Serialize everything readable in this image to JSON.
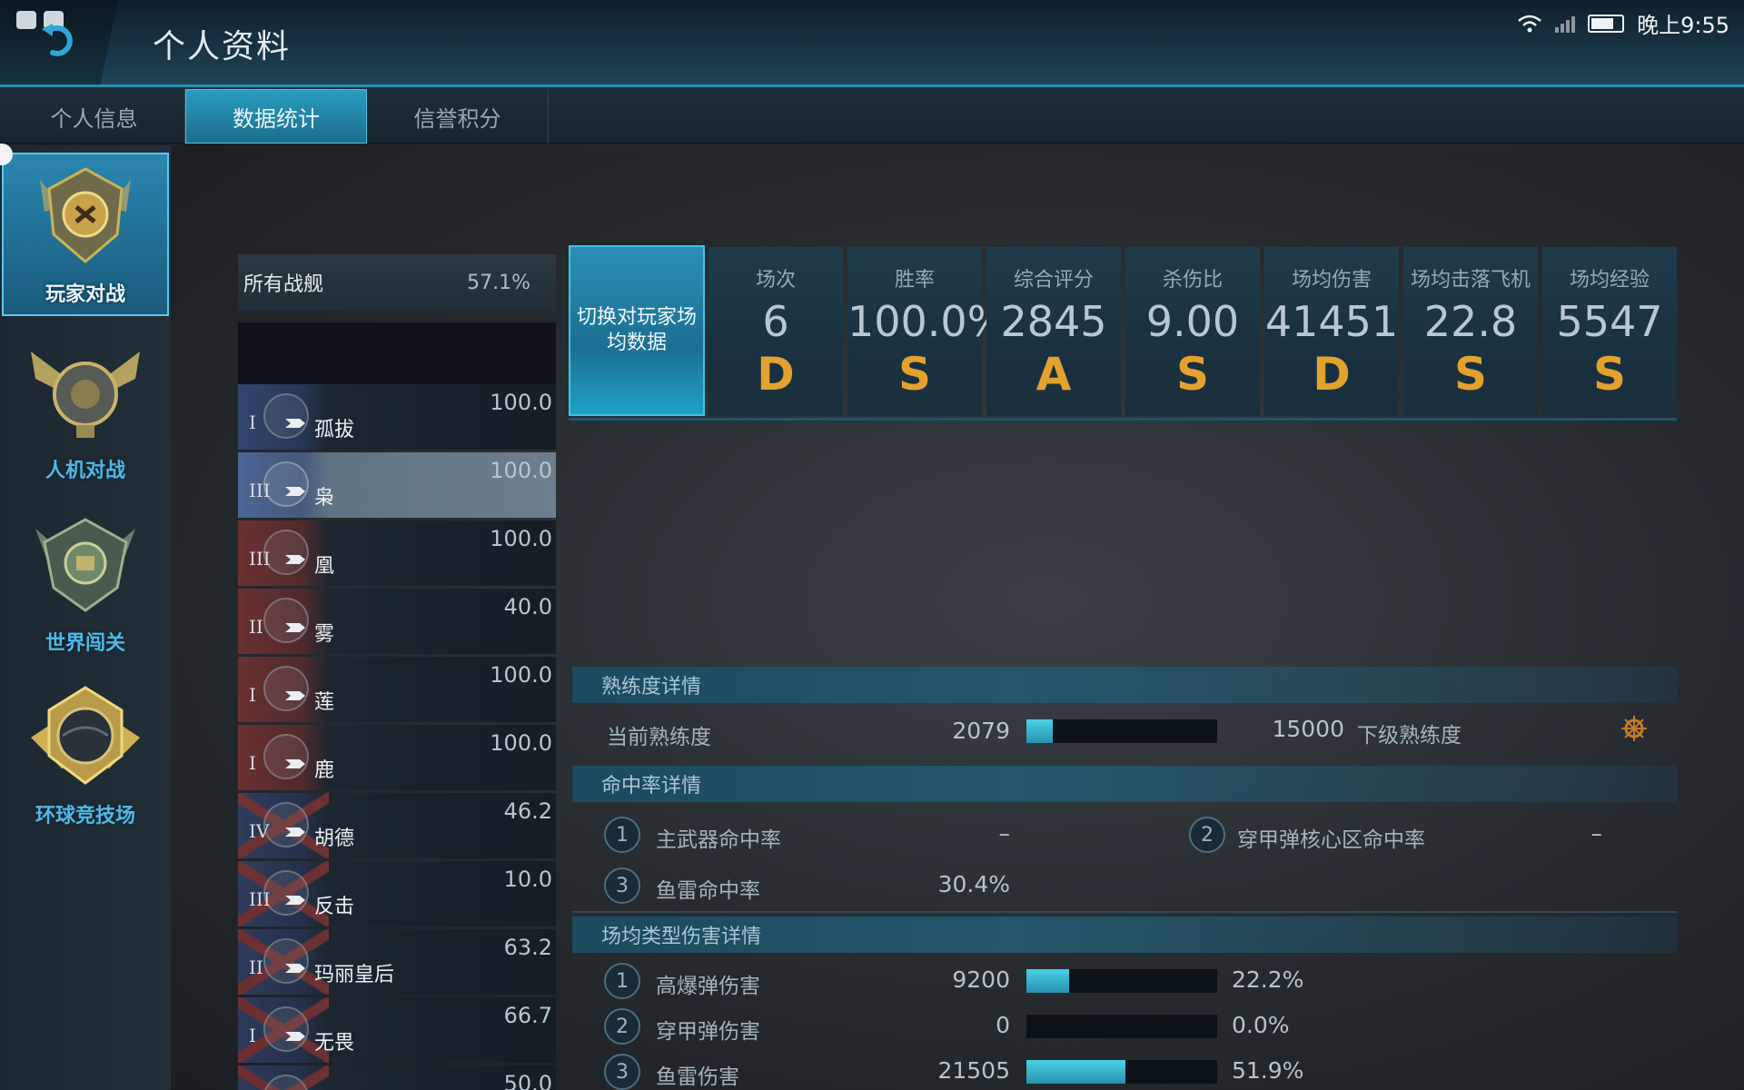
{
  "header": {
    "title": "个人资料",
    "time": "晚上9:55"
  },
  "tabs": [
    {
      "label": "个人信息"
    },
    {
      "label": "数据统计"
    },
    {
      "label": "信誉积分"
    }
  ],
  "modes": [
    {
      "label": "玩家对战",
      "icon": "pvp-emblem-icon"
    },
    {
      "label": "人机对战",
      "icon": "pve-emblem-icon"
    },
    {
      "label": "世界闯关",
      "icon": "world-emblem-icon"
    },
    {
      "label": "环球竞技场",
      "icon": "arena-emblem-icon"
    }
  ],
  "ship_filter": {
    "name": "所有战舰",
    "pct": "57.1%"
  },
  "ships": [
    {
      "tier": "I",
      "name": "孤拔",
      "score": "100.0",
      "flag": "blue"
    },
    {
      "tier": "III",
      "name": "枭",
      "score": "100.0",
      "flag": "blue"
    },
    {
      "tier": "III",
      "name": "凰",
      "score": "100.0",
      "flag": "red"
    },
    {
      "tier": "II",
      "name": "雾",
      "score": "40.0",
      "flag": "red"
    },
    {
      "tier": "I",
      "name": "莲",
      "score": "100.0",
      "flag": "red"
    },
    {
      "tier": "I",
      "name": "鹿",
      "score": "100.0",
      "flag": "red"
    },
    {
      "tier": "IV",
      "name": "胡德",
      "score": "46.2",
      "flag": "uk"
    },
    {
      "tier": "III",
      "name": "反击",
      "score": "10.0",
      "flag": "uk"
    },
    {
      "tier": "II",
      "name": "玛丽皇后",
      "score": "63.2",
      "flag": "uk"
    },
    {
      "tier": "I",
      "name": "无畏",
      "score": "66.7",
      "flag": "uk"
    },
    {
      "tier": "",
      "name": "",
      "score": "50.0",
      "flag": "uk"
    }
  ],
  "switch_button": "切换对玩家场均数据",
  "stats": [
    {
      "label": "场次",
      "value": "6",
      "grade": "D"
    },
    {
      "label": "胜率",
      "value": "100.0%",
      "grade": "S"
    },
    {
      "label": "综合评分",
      "value": "2845",
      "grade": "A"
    },
    {
      "label": "杀伤比",
      "value": "9.00",
      "grade": "S"
    },
    {
      "label": "场均伤害",
      "value": "41451",
      "grade": "D"
    },
    {
      "label": "场均击落飞机",
      "value": "22.8",
      "grade": "S"
    },
    {
      "label": "场均经验",
      "value": "5547",
      "grade": "S"
    }
  ],
  "proficiency": {
    "title": "熟练度详情",
    "current_label": "当前熟练度",
    "current_value": "2079",
    "max_value": "15000",
    "fill": 0.14,
    "next_label": "下级熟练度"
  },
  "accuracy": {
    "title": "命中率详情",
    "items": [
      {
        "idx": "1",
        "label": "主武器命中率",
        "value": "–"
      },
      {
        "idx": "2",
        "label": "穿甲弹核心区命中率",
        "value": "–"
      },
      {
        "idx": "3",
        "label": "鱼雷命中率",
        "value": "30.4%"
      }
    ]
  },
  "damage": {
    "title": "场均类型伤害详情",
    "items": [
      {
        "idx": "1",
        "label": "高爆弹伤害",
        "value": "9200",
        "pct": "22.2%",
        "fill": 0.222
      },
      {
        "idx": "2",
        "label": "穿甲弹伤害",
        "value": "0",
        "pct": "0.0%",
        "fill": 0.0
      },
      {
        "idx": "3",
        "label": "鱼雷伤害",
        "value": "21505",
        "pct": "51.9%",
        "fill": 0.519
      }
    ]
  }
}
